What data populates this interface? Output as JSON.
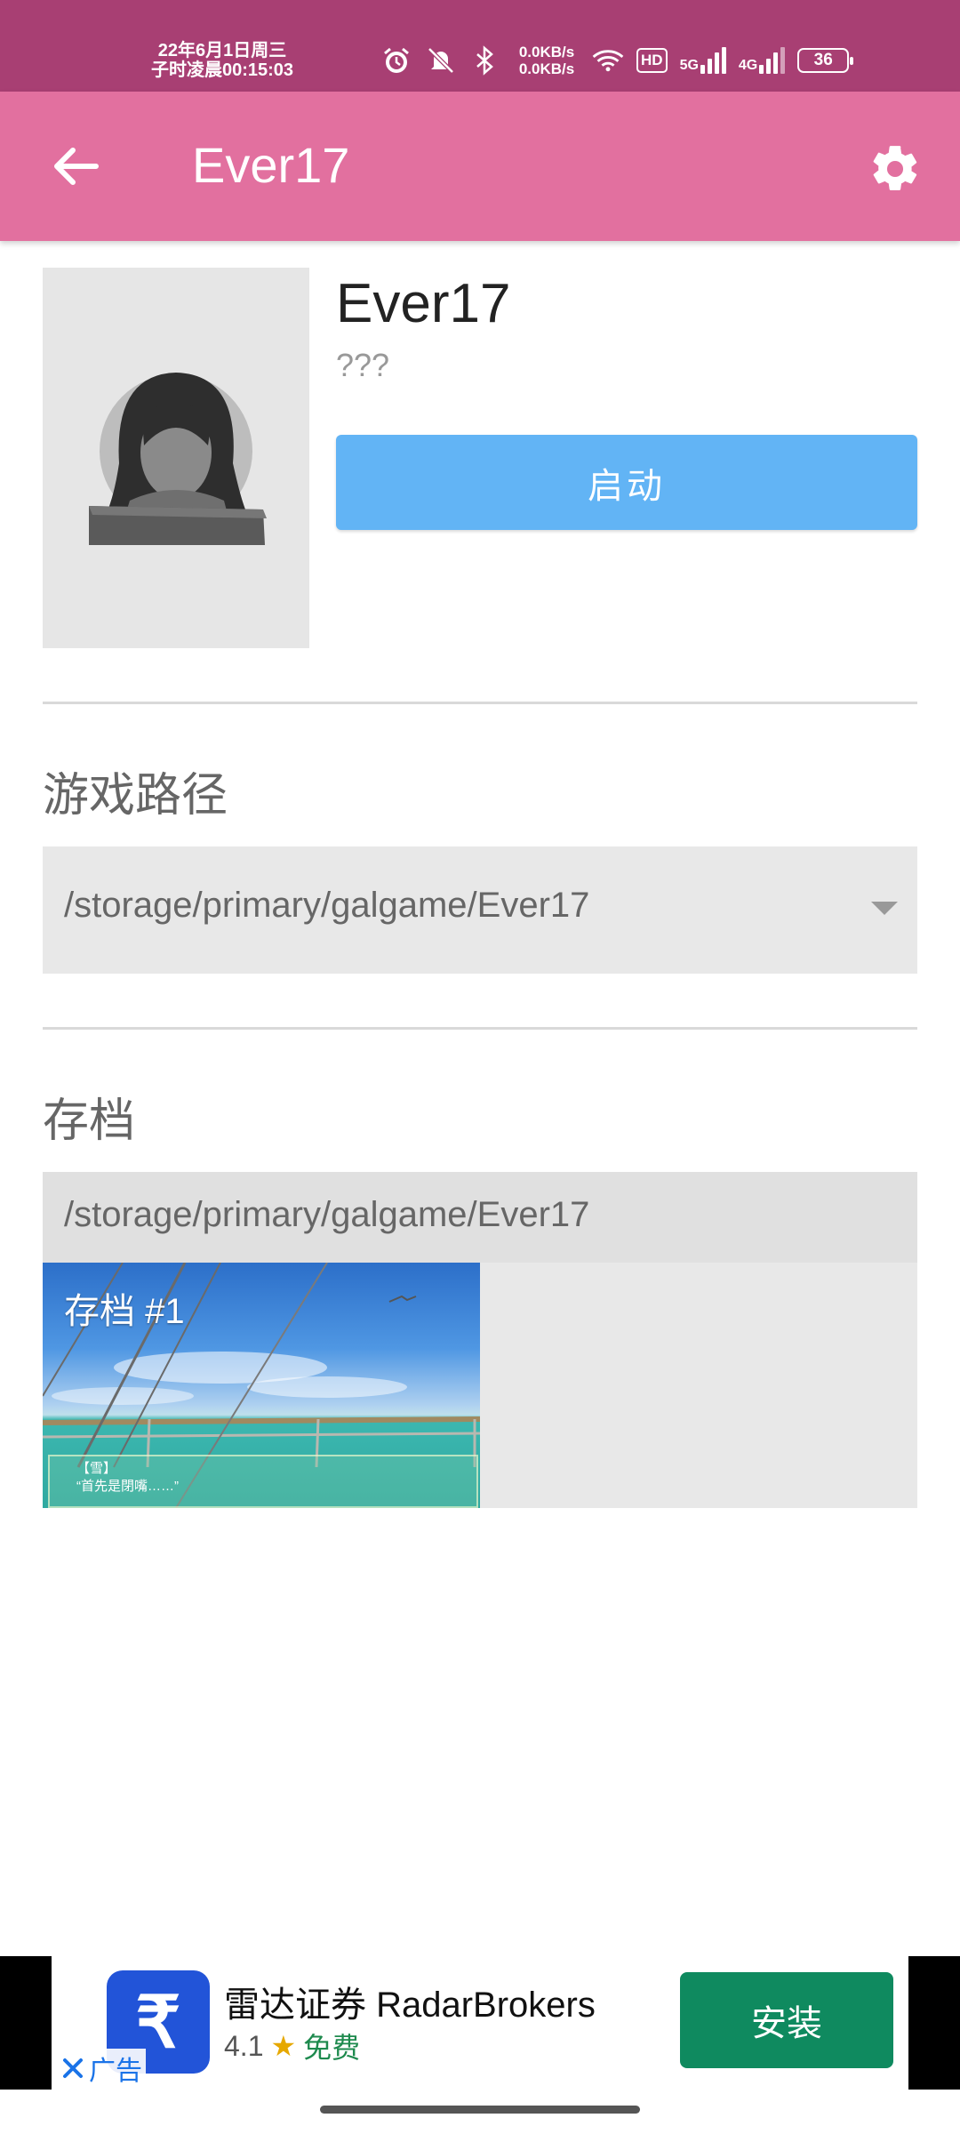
{
  "status_bar": {
    "date_line": "22年6月1日周三",
    "time_line": "子时凌晨00:15:03",
    "speed_up": "0.0KB/s",
    "speed_down": "0.0KB/s",
    "hd_label": "HD",
    "net_5g": "5G",
    "net_4g": "4G",
    "battery": "36",
    "icons": [
      "alarm-icon",
      "mute-icon",
      "bluetooth-icon",
      "wifi-icon",
      "signal-icon"
    ]
  },
  "app_bar": {
    "title": "Ever17",
    "back_icon": "arrow-left-icon",
    "settings_icon": "gear-icon",
    "color": "#e2709f"
  },
  "game": {
    "name": "Ever17",
    "subtitle": "???",
    "launch_label": "启动",
    "launch_color": "#62b4f5"
  },
  "path_section": {
    "title": "游戏路径",
    "selected": "/storage/primary/galgame/Ever17"
  },
  "save_section": {
    "title": "存档",
    "path": "/storage/primary/galgame/Ever17",
    "slots": [
      {
        "label": "存档 #1",
        "dialog_name": "【雪】",
        "dialog_text": "“首先是閉嘴……”"
      }
    ]
  },
  "ad": {
    "title": "雷达证券 RadarBrokers",
    "rating": "4.1",
    "price": "免费",
    "install_label": "安装",
    "close_label": "广告",
    "logo_glyph": "₹",
    "install_color": "#0f8a5f"
  }
}
